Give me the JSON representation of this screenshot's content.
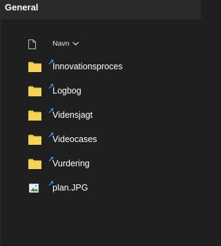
{
  "header": {
    "title": "General"
  },
  "list": {
    "column_name_label": "Navn",
    "column_icon": "document-icon",
    "sort_icon": "chevron-down-icon",
    "items": [
      {
        "label": "Innovationsproces",
        "icon": "folder-icon",
        "status_icon": "sync-icon"
      },
      {
        "label": "Logbog",
        "icon": "folder-icon",
        "status_icon": "sync-icon"
      },
      {
        "label": "Vidensjagt",
        "icon": "folder-icon",
        "status_icon": "sync-icon"
      },
      {
        "label": "Videocases",
        "icon": "folder-icon",
        "status_icon": "sync-icon"
      },
      {
        "label": "Vurdering",
        "icon": "folder-icon",
        "status_icon": "sync-icon"
      },
      {
        "label": "plan.JPG",
        "icon": "image-file-icon",
        "status_icon": "sync-icon"
      }
    ]
  },
  "colors": {
    "background": "#1f1f1f",
    "title_bar": "#2a2a2a",
    "folder": "#f3c94a",
    "accent": "#4aa3ff",
    "text": "#ffffff"
  }
}
